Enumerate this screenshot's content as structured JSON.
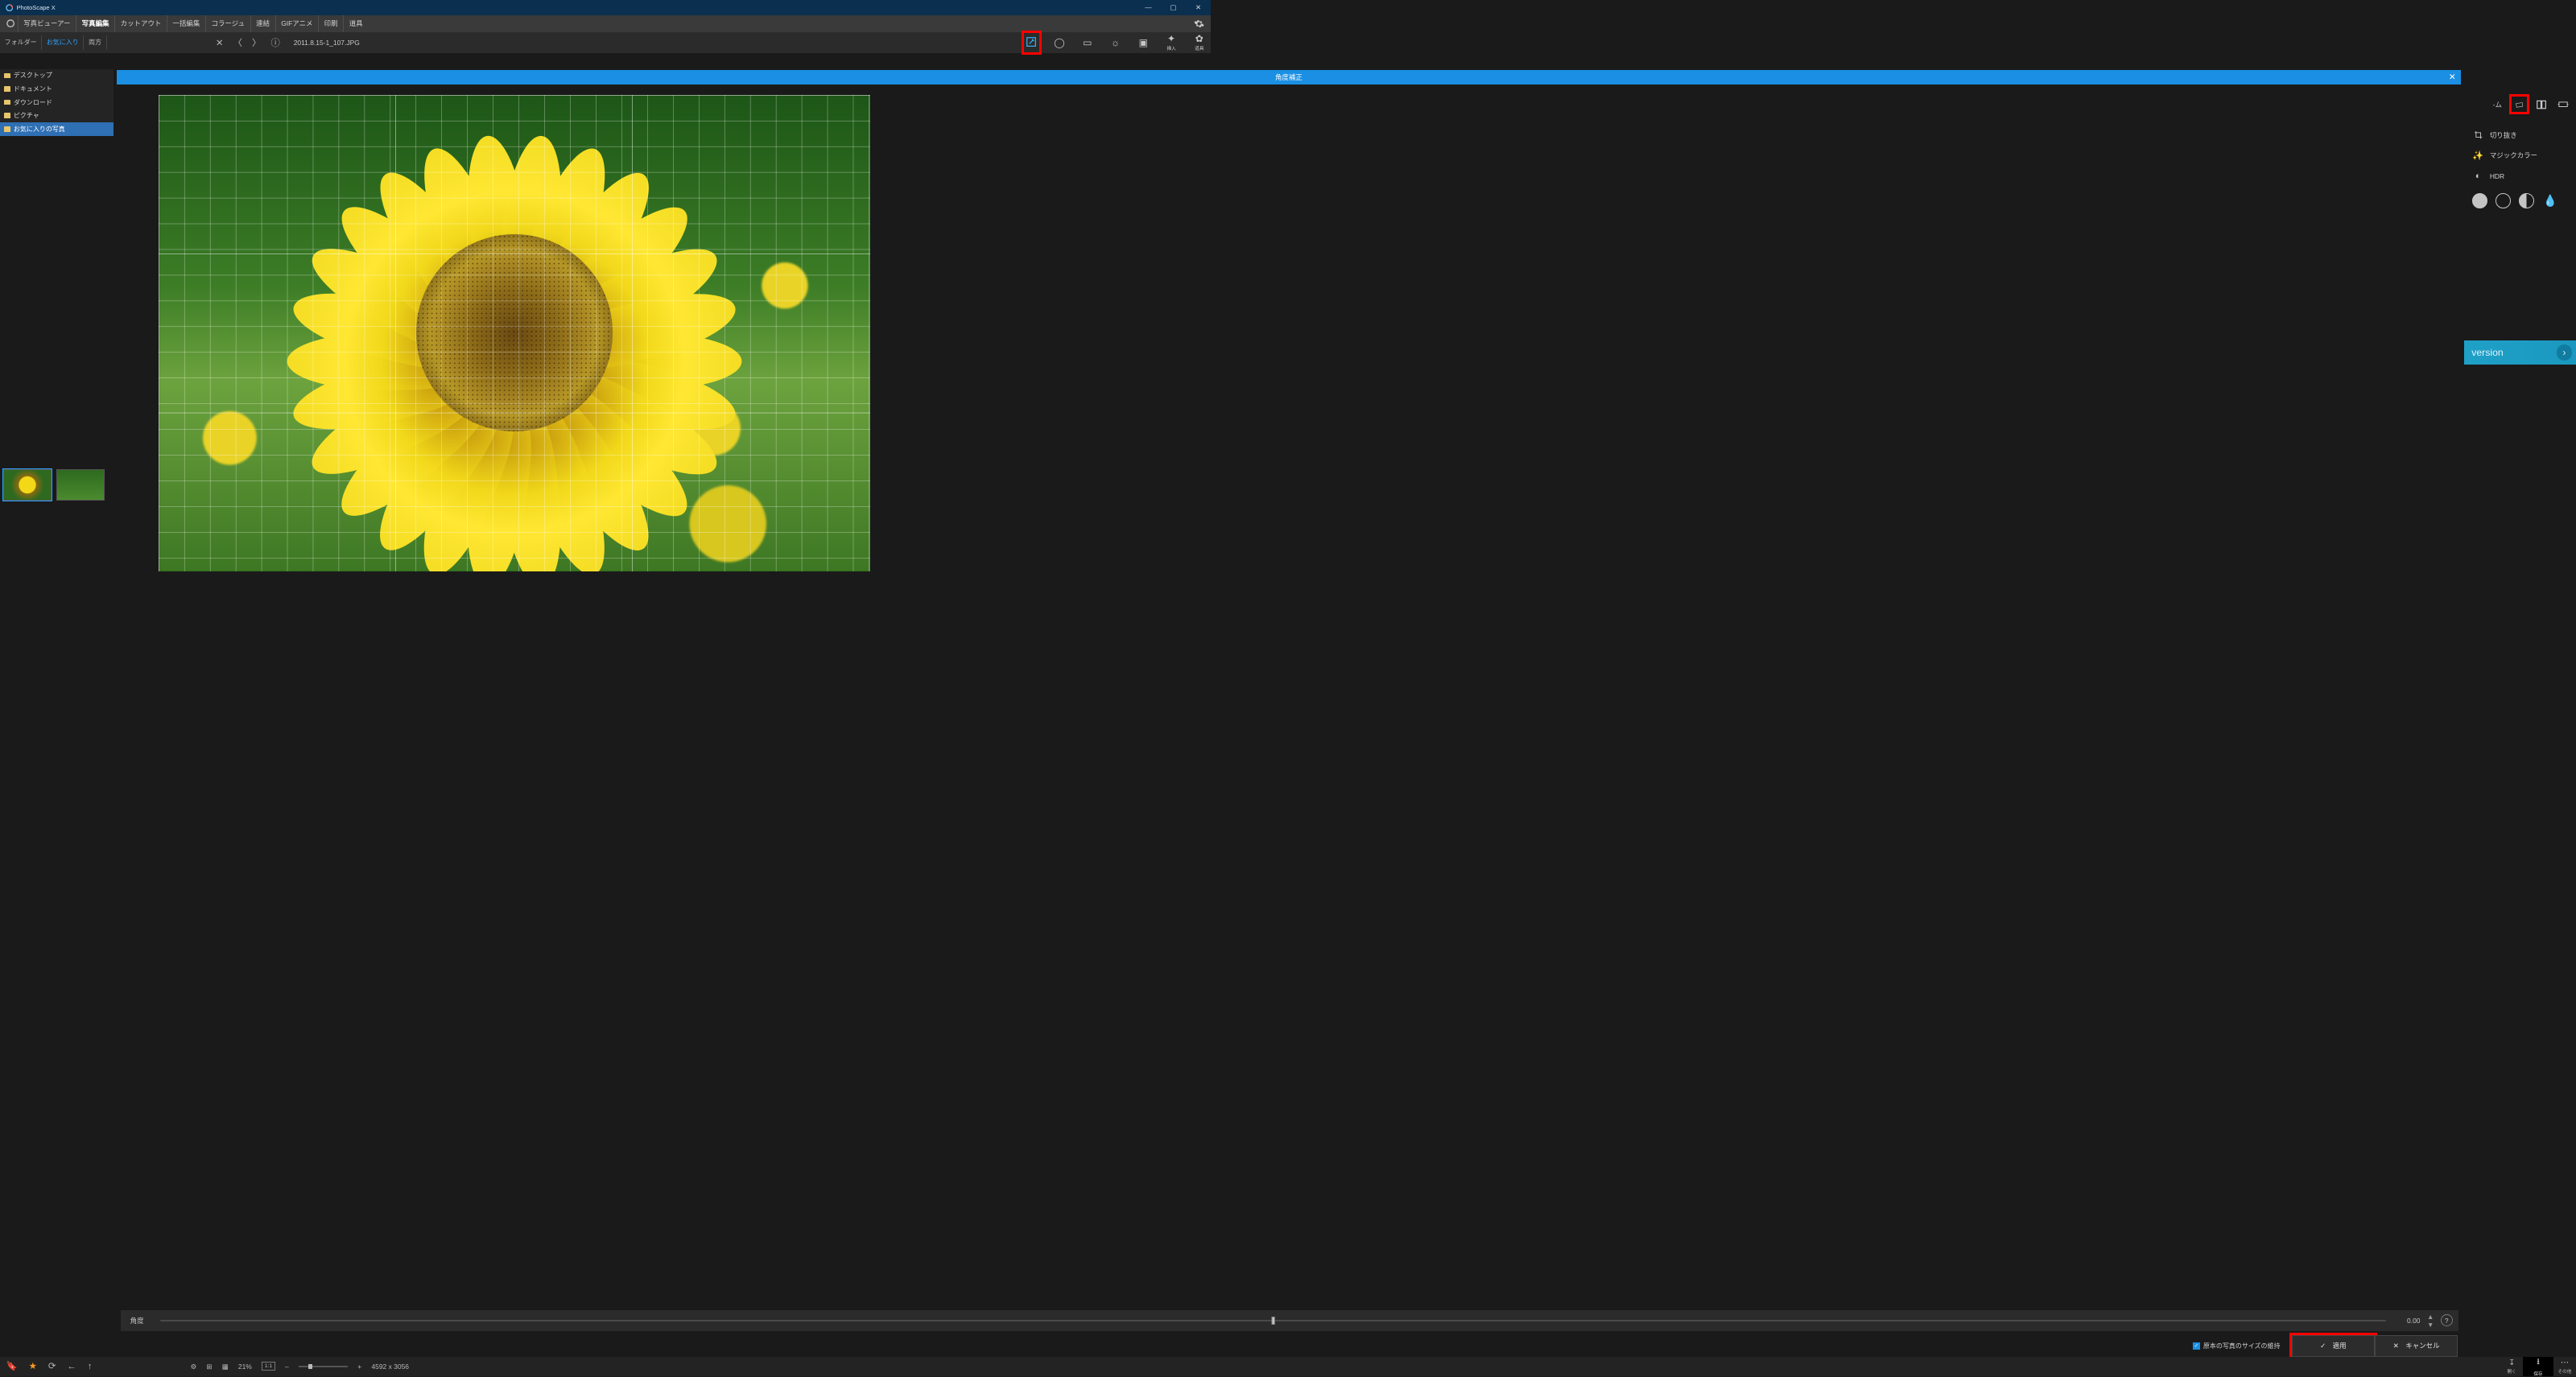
{
  "app": {
    "title": "PhotoScape X"
  },
  "menu": {
    "items": [
      "写真ビューアー",
      "写真編集",
      "カットアウト",
      "一括編集",
      "コラージュ",
      "連結",
      "GIFアニメ",
      "印刷",
      "道具"
    ],
    "active_index": 1
  },
  "loc_tabs": {
    "items": [
      "フォルダー",
      "お気に入り",
      "両方"
    ],
    "active_index": 1
  },
  "file": {
    "name": "2011.8.15-1_107.JPG"
  },
  "top_tools": [
    {
      "id": "edit",
      "label": "",
      "icon": "✎"
    },
    {
      "id": "circle",
      "label": "",
      "icon": "◯"
    },
    {
      "id": "film",
      "label": "",
      "icon": "▭"
    },
    {
      "id": "light",
      "label": "",
      "icon": "☼"
    },
    {
      "id": "frame",
      "label": "",
      "icon": "▣"
    },
    {
      "id": "insert",
      "label": "挿入",
      "icon": "✦"
    },
    {
      "id": "tools",
      "label": "道具",
      "icon": "✿"
    }
  ],
  "row2_tools": [
    {
      "id": "frame-like",
      "icon": "-ム"
    },
    {
      "id": "straighten",
      "icon": "▱"
    },
    {
      "id": "mirror",
      "icon": "◧"
    },
    {
      "id": "resize",
      "icon": "↔"
    }
  ],
  "sidebar": {
    "items": [
      "デスクトップ",
      "ドキュメント",
      "ダウンロード",
      "ピクチャ",
      "お気に入りの写真"
    ],
    "selected_index": 4
  },
  "modal": {
    "title": "角度補正",
    "angle_label": "角度",
    "angle_value": "0.00",
    "keep_size_label": "原本の写真のサイズの維持",
    "apply": "適用",
    "cancel": "キャンセル"
  },
  "right_panel": {
    "crop": "切り抜き",
    "magic": "マジックカラー",
    "hdr": "HDR"
  },
  "version_banner": {
    "text": "version"
  },
  "bottom": {
    "zoom_pct": "21%",
    "ratio": "1:1",
    "dims": "4592 x 3056",
    "open": "開く",
    "save": "保存",
    "other": "その他"
  }
}
